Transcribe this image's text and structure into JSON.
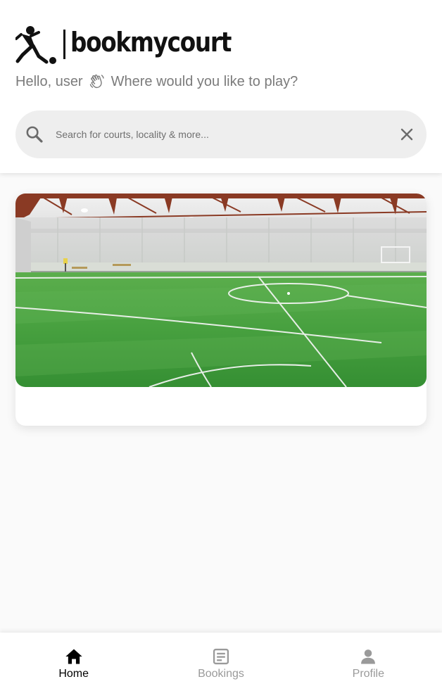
{
  "app": {
    "logo_text": "bookmycourt"
  },
  "header": {
    "greeting_prefix": "Hello, user",
    "greeting_suffix": "Where would you like to play?"
  },
  "search": {
    "placeholder": "Search for courts, locality & more...",
    "value": ""
  },
  "courts": [
    {
      "name": ""
    }
  ],
  "nav": {
    "items": [
      {
        "label": "Home",
        "icon": "home-icon",
        "active": true
      },
      {
        "label": "Bookings",
        "icon": "bookings-icon",
        "active": false
      },
      {
        "label": "Profile",
        "icon": "profile-icon",
        "active": false
      }
    ]
  },
  "colors": {
    "active": "#000000",
    "inactive": "#9a9a9a",
    "search_bg": "#eeeeee",
    "turf": "#3f9a3c"
  }
}
